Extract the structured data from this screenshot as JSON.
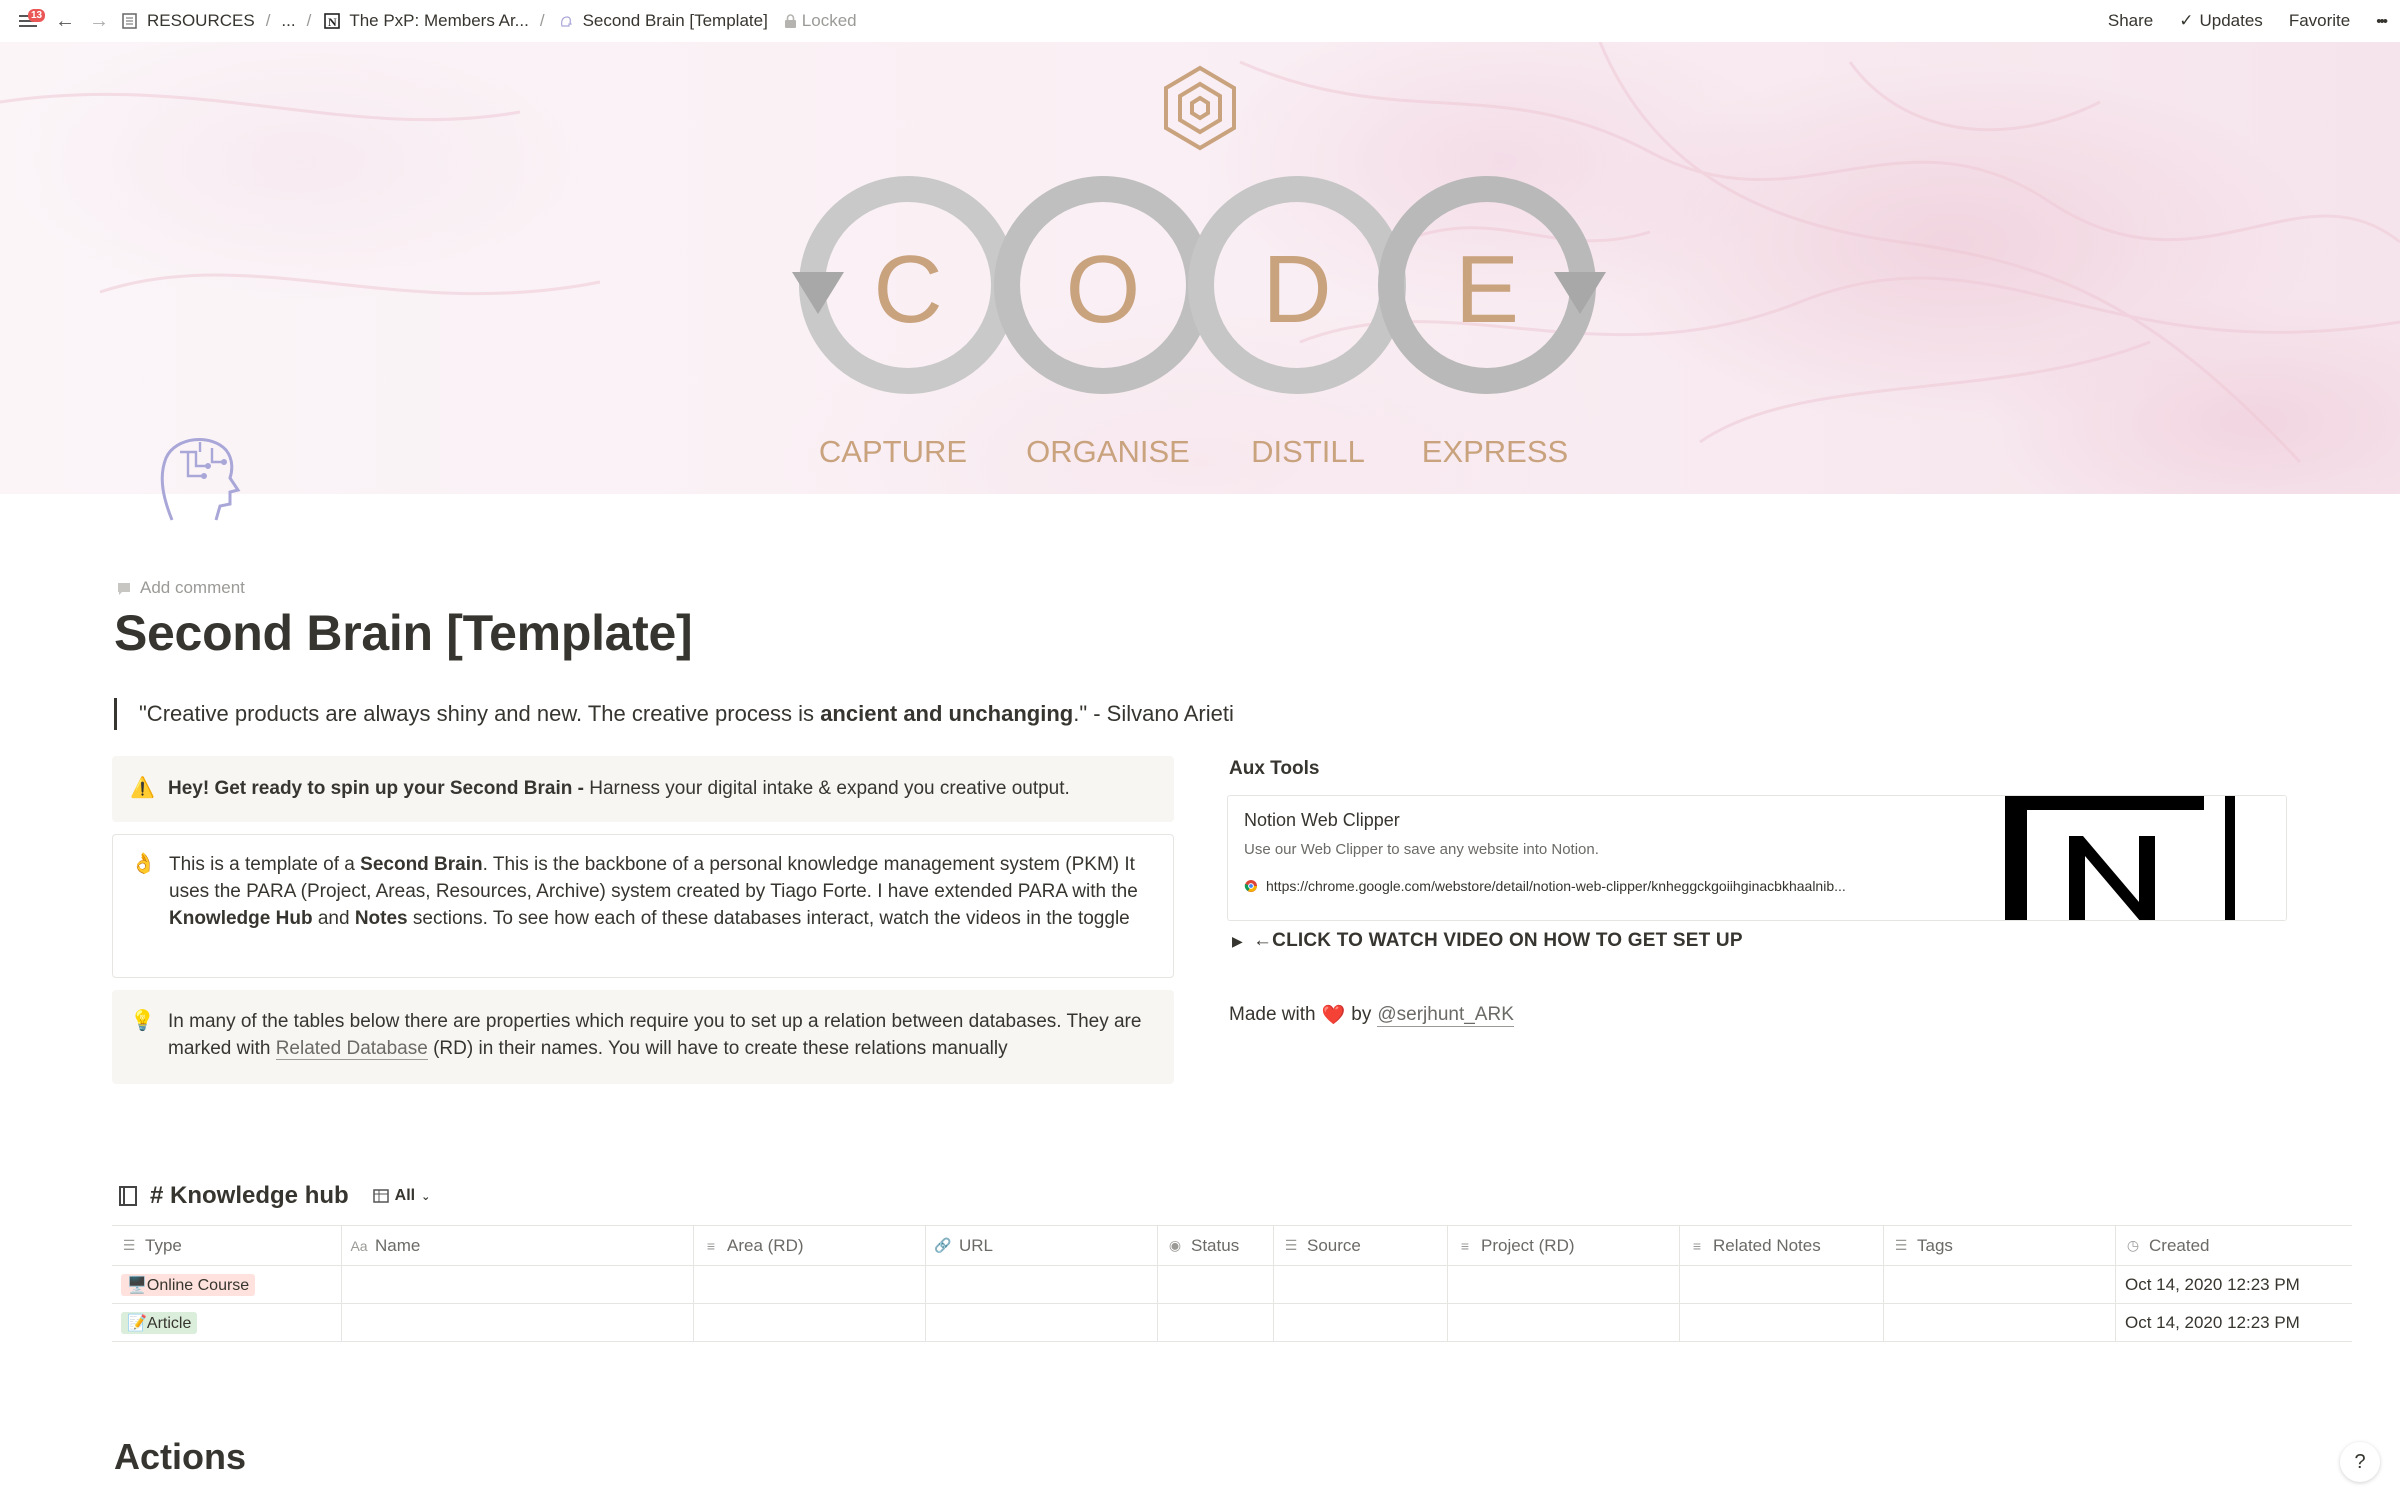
{
  "topbar": {
    "notification_count": "13",
    "breadcrumbs": [
      "RESOURCES",
      "...",
      "The PxP: Members Ar...",
      "Second Brain [Template]"
    ],
    "locked_label": "Locked",
    "share_label": "Share",
    "updates_label": "Updates",
    "favorite_label": "Favorite",
    "more_label": "•••"
  },
  "cover": {
    "letters": [
      "C",
      "O",
      "D",
      "E"
    ],
    "words": [
      "CAPTURE",
      "ORGANISE",
      "DISTILL",
      "EXPRESS"
    ]
  },
  "page": {
    "add_comment": "Add comment",
    "title": "Second Brain [Template]",
    "quote_start": "\"Creative products are always shiny and new. The creative process is ",
    "quote_bold": "ancient and unchanging",
    "quote_end": ".\" - Silvano Arieti"
  },
  "callouts": {
    "warning": {
      "icon": "⚠️",
      "bold": "Hey! Get ready to spin up your Second Brain - ",
      "text": "Harness your digital intake & expand you creative output."
    },
    "template": {
      "icon": "👌",
      "t1": "This is a template of a ",
      "b1": "Second Brain",
      "t2": ". This is the backbone of a personal knowledge management system (PKM) It uses the PARA (Project, Areas, Resources, Archive) system created by Tiago Forte. I have extended PARA with the ",
      "b2": "Knowledge Hub",
      "t3": " and ",
      "b3": "Notes",
      "t4": " sections. To see how each of these databases interact, watch the videos in the toggle"
    },
    "relation": {
      "icon": "💡",
      "t1": "In many of the tables below there are properties which require you to set up a relation between databases. They are marked with ",
      "link": "Related Database",
      "t2": " (RD) in their names. You will have to  create these relations manually"
    }
  },
  "aux": {
    "title": "Aux Tools",
    "bookmark": {
      "title": "Notion Web Clipper",
      "description": "Use our Web Clipper to save any website into Notion.",
      "url": "https://chrome.google.com/webstore/detail/notion-web-clipper/knheggckgoiihginacbkhaalnib..."
    },
    "toggle_label": "←CLICK TO WATCH VIDEO ON HOW TO GET SET UP",
    "made_with": "Made with",
    "heart": "❤️",
    "by": "by",
    "author": "@serjhunt_ARK"
  },
  "database": {
    "title": "# Knowledge hub",
    "view": "All",
    "columns": [
      {
        "name": "Type",
        "icon": "☰",
        "width": 230
      },
      {
        "name": "Name",
        "icon": "Aa",
        "width": 352
      },
      {
        "name": "Area (RD)",
        "icon": "≡",
        "width": 232
      },
      {
        "name": "URL",
        "icon": "🔗",
        "width": 232
      },
      {
        "name": "Status",
        "icon": "◉",
        "width": 116
      },
      {
        "name": "Source",
        "icon": "☰",
        "width": 174
      },
      {
        "name": "Project (RD)",
        "icon": "≡",
        "width": 232
      },
      {
        "name": "Related Notes",
        "icon": "≡",
        "width": 204
      },
      {
        "name": "Tags",
        "icon": "☰",
        "width": 232
      },
      {
        "name": "Created",
        "icon": "◷",
        "width": 236
      }
    ],
    "rows": [
      {
        "type": "🖥️Online Course",
        "type_color": "red",
        "created": "Oct 14, 2020 12:23 PM"
      },
      {
        "type": "📝Article",
        "type_color": "green",
        "created": "Oct 14, 2020 12:23 PM"
      }
    ]
  },
  "actions_title": "Actions",
  "help_label": "?",
  "colors": {
    "text": "#37352f",
    "muted": "#9b9a97",
    "code_gold": "#c9a27e",
    "ring_gray": "#bdbdbd",
    "tag_red": "#ffe2dd",
    "tag_green": "#dbeddb",
    "badge": "#eb5757"
  }
}
